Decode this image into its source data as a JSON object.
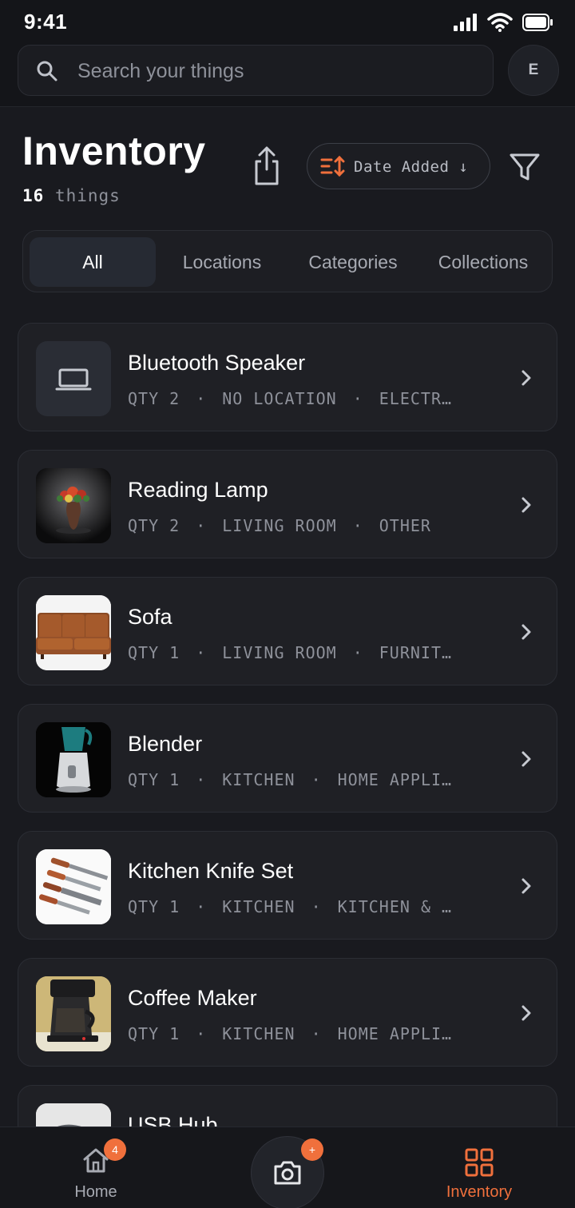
{
  "status_bar": {
    "time": "9:41"
  },
  "search": {
    "placeholder": "Search your things"
  },
  "avatar": {
    "initial": "E"
  },
  "header": {
    "title": "Inventory",
    "count_value": "16",
    "count_unit": "things",
    "sort_label": "Date Added ↓"
  },
  "tabs": [
    {
      "label": "All",
      "active": true
    },
    {
      "label": "Locations",
      "active": false
    },
    {
      "label": "Categories",
      "active": false
    },
    {
      "label": "Collections",
      "active": false
    }
  ],
  "items": [
    {
      "name": "Bluetooth Speaker",
      "qty": "QTY 2",
      "location": "NO LOCATION",
      "category": "ELECTR…",
      "thumb": "laptop-placeholder-icon"
    },
    {
      "name": "Reading Lamp",
      "qty": "QTY 2",
      "location": "LIVING ROOM",
      "category": "OTHER",
      "thumb": "vase-photo"
    },
    {
      "name": "Sofa",
      "qty": "QTY 1",
      "location": "LIVING ROOM",
      "category": "FURNIT…",
      "thumb": "sofa-photo"
    },
    {
      "name": "Blender",
      "qty": "QTY 1",
      "location": "KITCHEN",
      "category": "HOME APPLI…",
      "thumb": "blender-photo"
    },
    {
      "name": "Kitchen Knife Set",
      "qty": "QTY 1",
      "location": "KITCHEN",
      "category": "KITCHEN & …",
      "thumb": "knives-photo"
    },
    {
      "name": "Coffee Maker",
      "qty": "QTY 1",
      "location": "KITCHEN",
      "category": "HOME APPLI…",
      "thumb": "coffee-maker-photo"
    },
    {
      "name": "USB Hub",
      "qty": "",
      "location": "",
      "category": "",
      "thumb": "usb-hub-photo"
    }
  ],
  "meta_separator": "·",
  "bottom_nav": {
    "home_label": "Home",
    "home_badge": "4",
    "camera_badge": "+",
    "inventory_label": "Inventory"
  },
  "colors": {
    "background": "#191a1f",
    "card": "#1f2025",
    "accent": "#f0703c",
    "muted_text": "#8e919a"
  }
}
